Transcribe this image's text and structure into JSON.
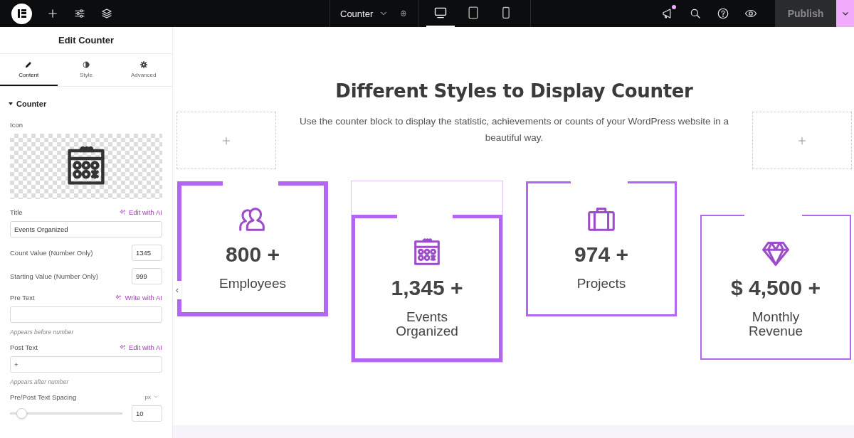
{
  "topbar": {
    "document": "Counter",
    "devices": [
      {
        "kind": "desktop",
        "selected": true
      },
      {
        "kind": "tablet",
        "selected": false
      },
      {
        "kind": "mobile",
        "selected": false
      }
    ],
    "notification": true,
    "publish": "Publish"
  },
  "panel": {
    "title": "Edit Counter",
    "tabs": [
      {
        "kind": "content",
        "label": "Content",
        "selected": true
      },
      {
        "kind": "style",
        "label": "Style",
        "selected": false
      },
      {
        "kind": "advanced",
        "label": "Advanced",
        "selected": false
      }
    ],
    "section": {
      "title": "Counter",
      "expanded": true
    },
    "icon_label": "Icon",
    "fields": [
      {
        "kind": "text",
        "label": "Title",
        "ai": "Edit with AI",
        "value": "Events Organized"
      },
      {
        "kind": "number",
        "label": "Count Value (Number Only)",
        "value": "1345"
      },
      {
        "kind": "number",
        "label": "Starting Value (Number Only)",
        "value": "999"
      },
      {
        "kind": "text",
        "label": "Pre Text",
        "ai": "Write with AI",
        "help": "Appears before number"
      },
      {
        "kind": "text",
        "label": "Post Text",
        "ai": "Edit with AI",
        "value": "+",
        "help": "Appears after number"
      },
      {
        "kind": "slider",
        "label": "Pre/Post Text Spacing",
        "unit": "px",
        "level": 0.1,
        "value": "10"
      }
    ]
  },
  "collapse_handle": "‹",
  "canvas": {
    "heading": "Different Styles to Display Counter",
    "text": "Use the counter block to display the statistic, achievements or counts of your WordPress website in a beautiful way.",
    "counters": [
      {
        "number": "800 +",
        "label": "Employees",
        "selected": false
      },
      {
        "number": "1,345 +",
        "label": "Events Organized",
        "selected": true
      },
      {
        "number": "974 +",
        "label": "Projects",
        "selected": false
      },
      {
        "number": "$ 4,500 +",
        "label": "Monthly Revenue",
        "selected": false
      }
    ]
  }
}
